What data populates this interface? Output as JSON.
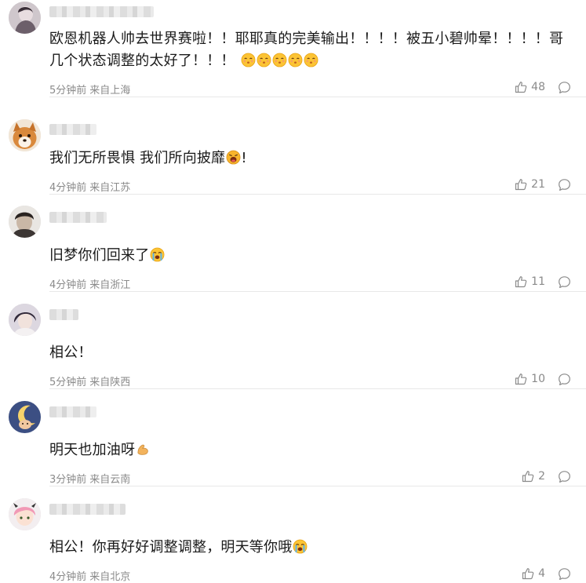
{
  "comments": [
    {
      "text": "欧恩机器人帅去世界赛啦！！耶耶真的完美输出！！！！被五小碧帅晕！！！！哥几个状态调整的太好了！！！",
      "emoji": "kiss-emoji x5",
      "time": "5分钟前",
      "location": "来自上海",
      "likes": "48"
    },
    {
      "text": "我们无所畏惧 我们所向披靡",
      "emoji": "shout-emoji",
      "suffix": "!",
      "time": "4分钟前",
      "location": "来自江苏",
      "likes": "21"
    },
    {
      "text": "旧梦你们回来了",
      "emoji": "crying-emoji",
      "time": "4分钟前",
      "location": "来自浙江",
      "likes": "11"
    },
    {
      "text": "相公！",
      "time": "5分钟前",
      "location": "来自陕西",
      "likes": "10"
    },
    {
      "text": "明天也加油呀",
      "emoji": "flexed-arm-emoji",
      "time": "3分钟前",
      "location": "来自云南",
      "likes": "2"
    },
    {
      "text": "相公！你再好好调整调整，明天等你哦",
      "emoji": "crying-emoji",
      "time": "4分钟前",
      "location": "来自北京",
      "likes": "4"
    }
  ]
}
